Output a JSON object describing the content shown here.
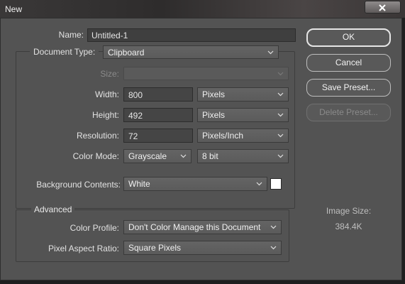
{
  "window": {
    "title": "New"
  },
  "name": {
    "label": "Name:",
    "value": "Untitled-1"
  },
  "document_type": {
    "label": "Document Type:",
    "value": "Clipboard"
  },
  "size": {
    "label": "Size:",
    "value": ""
  },
  "width": {
    "label": "Width:",
    "value": "800",
    "unit": "Pixels"
  },
  "height": {
    "label": "Height:",
    "value": "492",
    "unit": "Pixels"
  },
  "resolution": {
    "label": "Resolution:",
    "value": "72",
    "unit": "Pixels/Inch"
  },
  "color_mode": {
    "label": "Color Mode:",
    "value": "Grayscale",
    "depth": "8 bit"
  },
  "background": {
    "label": "Background Contents:",
    "value": "White",
    "swatch_color": "#ffffff"
  },
  "advanced": {
    "heading": "Advanced",
    "color_profile": {
      "label": "Color Profile:",
      "value": "Don't Color Manage this Document"
    },
    "pixel_aspect": {
      "label": "Pixel Aspect Ratio:",
      "value": "Square Pixels"
    }
  },
  "buttons": {
    "ok": "OK",
    "cancel": "Cancel",
    "save_preset": "Save Preset...",
    "delete_preset": "Delete Preset..."
  },
  "image_size": {
    "label": "Image Size:",
    "value": "384.4K"
  },
  "icons": {
    "dropdown": "chevron-down-icon",
    "close": "close-icon"
  }
}
